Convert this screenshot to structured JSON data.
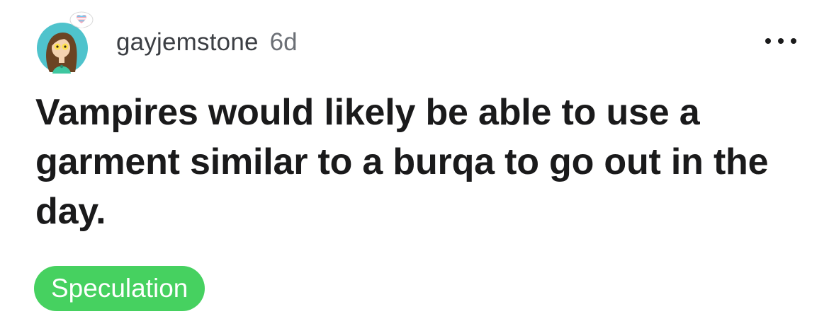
{
  "post": {
    "author": "gayjemstone",
    "age": "6d",
    "title": "Vampires would likely be able to use a garment similar to a burqa to go out in the day.",
    "flair": "Speculation",
    "more_icon": "more-horizontal-icon"
  },
  "colors": {
    "flair_background": "#46d160",
    "flair_text": "#ffffff",
    "title_text": "#1a1a1b",
    "meta_text": "#6b6f75",
    "avatar_background": "#4fc3cc"
  }
}
